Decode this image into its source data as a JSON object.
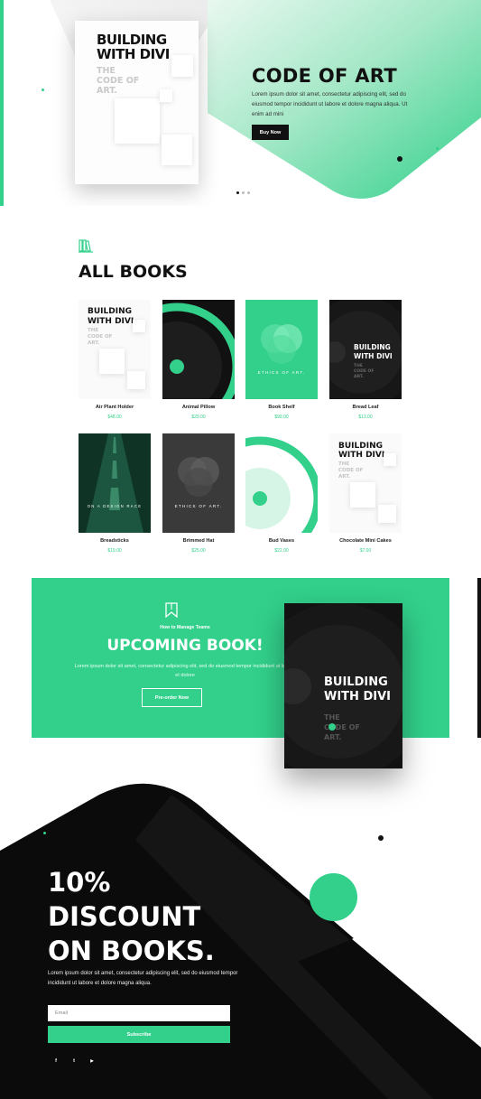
{
  "colors": {
    "accent": "#32d08b",
    "dark": "#111111",
    "light_green": "#c8f1de"
  },
  "hero": {
    "book": {
      "title_line1": "BUILDING",
      "title_line2": "WITH DIVI",
      "sub_line1": "THE",
      "sub_line2": "CODE OF",
      "sub_line3": "ART."
    },
    "title": "CODE OF ART",
    "text": "Lorem ipsum dolor sit amet, consectetur adipiscing elit, sed do eiusmod tempor incididunt ut labore et dolore magna aliqua. Ut enim ad mini",
    "button": "Buy Now"
  },
  "books_section": {
    "icon": "books-icon",
    "title": "ALL BOOKS",
    "products": [
      {
        "name": "Air Plant Holder",
        "price": "$48.00",
        "cover": "white-divi"
      },
      {
        "name": "Animal Pillow",
        "price": "$29.00",
        "cover": "black-green-circle"
      },
      {
        "name": "Book Shelf",
        "price": "$99.00",
        "cover": "green-ethics",
        "label": "ETHICS OF ART."
      },
      {
        "name": "Bread Leaf",
        "price": "$13.00",
        "cover": "black-divi"
      },
      {
        "name": "Breadsticks",
        "price": "$19.00",
        "cover": "dark-road",
        "label": "ON A DESIGN RACE"
      },
      {
        "name": "Brimmed Hat",
        "price": "$25.00",
        "cover": "gray-ethics",
        "label": "ETHICS OF ART."
      },
      {
        "name": "Bud Vases",
        "price": "$22.00",
        "cover": "white-green-circle"
      },
      {
        "name": "Chocolate Mini Cakes",
        "price": "$7.00",
        "cover": "white-divi"
      }
    ],
    "divi_cover": {
      "title_line1": "BUILDING",
      "title_line2": "WITH DIVI",
      "sub_line1": "THE",
      "sub_line2": "CODE OF",
      "sub_line3": "ART."
    }
  },
  "upcoming": {
    "icon": "bookmark-icon",
    "eyebrow": "How to Manage Teams",
    "title": "UPCOMING BOOK!",
    "text": "Lorem ipsum dolor sit amet, consectetur adipiscing elit, sed do eiusmod tempor incididunt ut labore et dolore",
    "button": "Pre-order Now",
    "book": {
      "title_line1": "BUILDING",
      "title_line2": "WITH DIVI",
      "sub_line1": "THE",
      "sub_line2": "CODE OF",
      "sub_line3": "ART."
    }
  },
  "discount": {
    "title_line1": "10%",
    "title_line2": "DISCOUNT",
    "title_line3": "ON BOOKS.",
    "text": "Lorem ipsum dolor sit amet, consectetur adipiscing elit, sed do eiusmod tempor incididunt ut labore et dolore magna aliqua.",
    "email_placeholder": "Email",
    "button": "Subscribe",
    "social": [
      {
        "icon": "facebook-icon",
        "glyph": "f"
      },
      {
        "icon": "twitter-icon",
        "glyph": "t"
      },
      {
        "icon": "youtube-icon",
        "glyph": "▶"
      }
    ]
  }
}
